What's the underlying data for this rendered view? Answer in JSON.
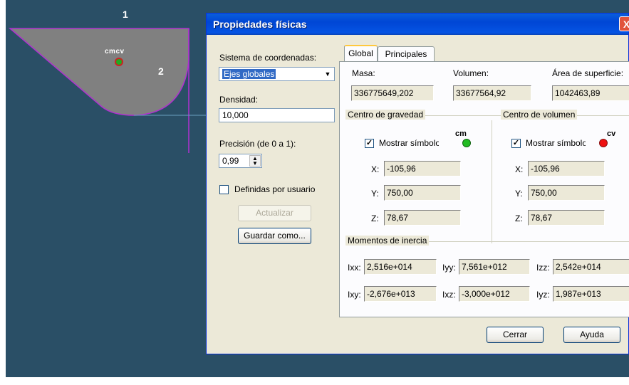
{
  "viewport": {
    "label_1": "1",
    "label_2": "2",
    "marker_label": "cmcv"
  },
  "dialog": {
    "title": "Propiedades físicas",
    "close": "X",
    "left": {
      "coord_label": "Sistema de coordenadas:",
      "coord_value": "Ejes globales",
      "density_label": "Densidad:",
      "density_value": "10,000",
      "precision_label": "Precisión (de 0 a 1):",
      "precision_value": "0,99",
      "user_defined_label": "Definidas por usuario",
      "update_button": "Actualizar",
      "save_button": "Guardar como..."
    },
    "tabs": [
      "Global",
      "Principales"
    ],
    "global": {
      "mass_label": "Masa:",
      "mass_value": "336775649,202",
      "volume_label": "Volumen:",
      "volume_value": "33677564,92",
      "area_label": "Área de superficie:",
      "area_value": "1042463,89",
      "cog_group": "Centro de gravedad",
      "cov_group": "Centro de volumen",
      "show_symbol": "Mostrar símbolo",
      "cm_symbol": "cm",
      "cv_symbol": "cv",
      "cog": {
        "x_label": "X:",
        "x": "-105,96",
        "y_label": "Y:",
        "y": "750,00",
        "z_label": "Z:",
        "z": "78,67"
      },
      "cov": {
        "x_label": "X:",
        "x": "-105,96",
        "y_label": "Y:",
        "y": "750,00",
        "z_label": "Z:",
        "z": "78,67"
      },
      "inertia_group": "Momentos de inercia",
      "inertia": {
        "ixx_label": "Ixx:",
        "ixx": "2,516e+014",
        "iyy_label": "Iyy:",
        "iyy": "7,561e+012",
        "izz_label": "Izz:",
        "izz": "2,542e+014",
        "ixy_label": "Ixy:",
        "ixy": "-2,676e+013",
        "ixz_label": "Ixz:",
        "ixz": "-3,000e+012",
        "iyz_label": "Iyz:",
        "iyz": "1,987e+013"
      }
    },
    "close_button": "Cerrar",
    "help_button": "Ayuda"
  },
  "colors": {
    "background": "#2a4f66",
    "shape_fill": "#808080",
    "shape_edge": "#b030d0",
    "cm_symbol": "#22bb22",
    "cv_symbol": "#ee1111"
  }
}
